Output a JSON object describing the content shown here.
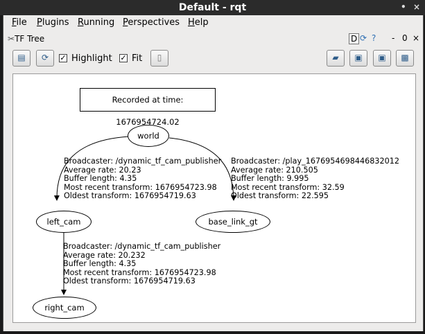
{
  "window": {
    "title": "Default - rqt",
    "controls": [
      "•",
      "×"
    ]
  },
  "menubar": {
    "items": [
      {
        "label": "File",
        "mnemonic": "F",
        "rest": "ile"
      },
      {
        "label": "Plugins",
        "mnemonic": "P",
        "rest": "lugins"
      },
      {
        "label": "Running",
        "mnemonic": "R",
        "rest": "unning"
      },
      {
        "label": "Perspectives",
        "mnemonic": "P",
        "rest": "erspectives"
      },
      {
        "label": "Help",
        "mnemonic": "H",
        "rest": "elp"
      }
    ]
  },
  "plugin": {
    "title": "TF Tree",
    "dock_letter": "D",
    "minimize": "-",
    "instance": "0"
  },
  "toolbar": {
    "highlight_label": "Highlight",
    "highlight_checked": true,
    "fit_label": "Fit",
    "fit_checked": true,
    "check_glyph": "✓"
  },
  "graph": {
    "recorded": "Recorded at time: 1676954724.02",
    "nodes": {
      "world": "world",
      "left_cam": "left_cam",
      "base_link_gt": "base_link_gt",
      "right_cam": "right_cam"
    },
    "edges": {
      "world_left_cam": [
        "Broadcaster: /dynamic_tf_cam_publisher",
        "Average rate: 20.23",
        "Buffer length: 4.35",
        "Most recent transform: 1676954723.98",
        "Oldest transform: 1676954719.63"
      ],
      "world_base_link_gt": [
        "Broadcaster: /play_1676954698446832012",
        "Average rate: 210.505",
        "Buffer length: 9.995",
        "Most recent transform: 32.59",
        "Oldest transform: 22.595"
      ],
      "left_cam_right_cam": [
        "Broadcaster: /dynamic_tf_cam_publisher",
        "Average rate: 20.232",
        "Buffer length: 4.35",
        "Most recent transform: 1676954723.98",
        "Oldest transform: 1676954719.63"
      ]
    }
  }
}
